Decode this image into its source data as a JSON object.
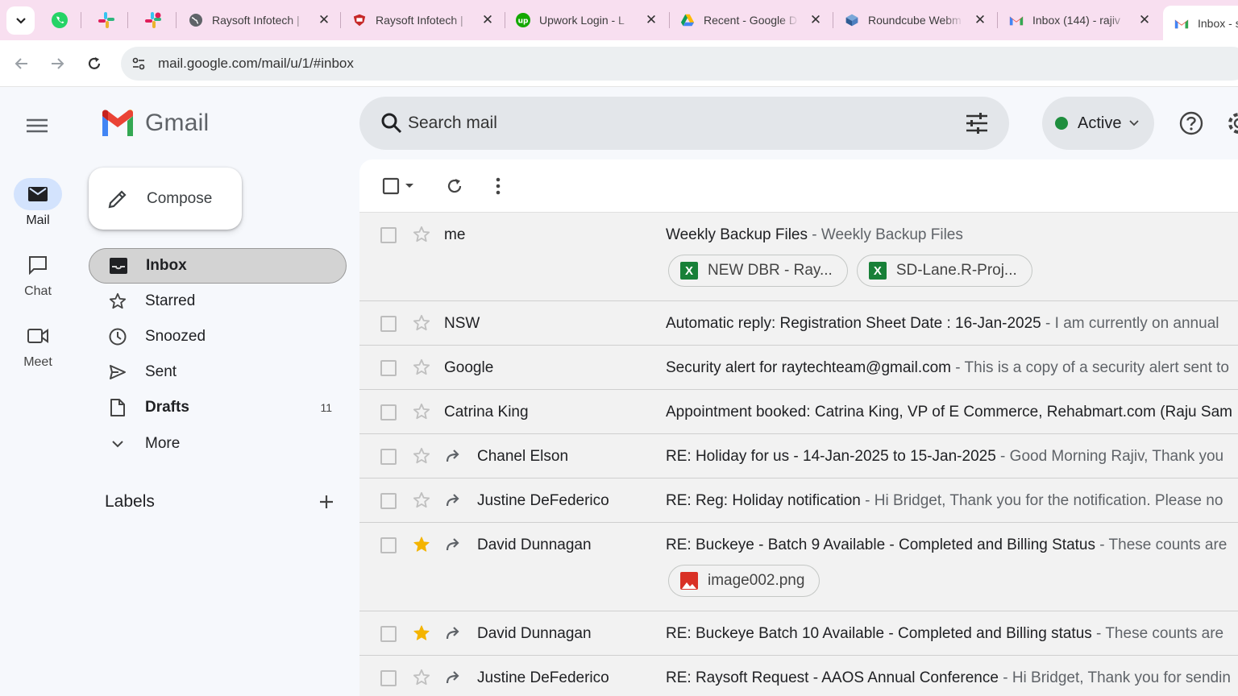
{
  "browser": {
    "tabs": [
      {
        "title": "Raysoft Infotech | ",
        "favicon": "globe-icon"
      },
      {
        "title": "Raysoft Infotech | ",
        "favicon": "raysoft-icon"
      },
      {
        "title": "Upwork Login - L",
        "favicon": "upwork-icon"
      },
      {
        "title": "Recent - Google D",
        "favicon": "google-drive-icon"
      },
      {
        "title": "Roundcube Webm",
        "favicon": "roundcube-icon"
      },
      {
        "title": "Inbox (144) - rajiv",
        "favicon": "gmail-icon"
      },
      {
        "title": "Inbox - s",
        "favicon": "gmail-icon"
      }
    ],
    "url": "mail.google.com/mail/u/1/#inbox"
  },
  "rail": {
    "mail": "Mail",
    "chat": "Chat",
    "meet": "Meet"
  },
  "app": {
    "name": "Gmail",
    "compose": "Compose",
    "folders": [
      {
        "label": "Inbox",
        "count": ""
      },
      {
        "label": "Starred",
        "count": ""
      },
      {
        "label": "Snoozed",
        "count": ""
      },
      {
        "label": "Sent",
        "count": ""
      },
      {
        "label": "Drafts",
        "count": "11"
      },
      {
        "label": "More",
        "count": ""
      }
    ],
    "labels_heading": "Labels"
  },
  "search": {
    "placeholder": "Search mail"
  },
  "status": {
    "label": "Active",
    "color": "#1e8e3e"
  },
  "emails": [
    {
      "sender": "me",
      "subject": "Weekly Backup Files",
      "snippet": " - Weekly Backup Files",
      "starred": false,
      "forwarded": false,
      "attachments": [
        {
          "name": "NEW DBR - Ray...",
          "type": "xls"
        },
        {
          "name": "SD-Lane.R-Proj...",
          "type": "xls"
        }
      ]
    },
    {
      "sender": "NSW",
      "subject": "Automatic reply: Registration Sheet Date : 16-Jan-2025",
      "snippet": " -  I am currently on annual",
      "starred": false,
      "forwarded": false,
      "attachments": []
    },
    {
      "sender": "Google",
      "subject": "Security alert for raytechteam@gmail.com",
      "snippet": " - This is a copy of a security alert sent to",
      "starred": false,
      "forwarded": false,
      "attachments": []
    },
    {
      "sender": "Catrina King",
      "subject": "Appointment booked: Catrina King, VP of E Commerce, Rehabmart.com (Raju Sam",
      "snippet": "",
      "starred": false,
      "forwarded": false,
      "attachments": []
    },
    {
      "sender": "Chanel Elson",
      "subject": "RE: Holiday for us - 14-Jan-2025 to 15-Jan-2025",
      "snippet": " - Good Morning Rajiv, Thank you",
      "starred": false,
      "forwarded": true,
      "attachments": []
    },
    {
      "sender": "Justine DeFederico",
      "subject": "RE: Reg: Holiday notification",
      "snippet": " - Hi Bridget, Thank you for the notification. Please no",
      "starred": false,
      "forwarded": true,
      "attachments": []
    },
    {
      "sender": "David Dunnagan",
      "subject": "RE: Buckeye - Batch 9 Available - Completed and Billing Status",
      "snippet": " - These counts are",
      "starred": true,
      "forwarded": true,
      "attachments": [
        {
          "name": "image002.png",
          "type": "image"
        }
      ]
    },
    {
      "sender": "David Dunnagan",
      "subject": "RE: Buckeye Batch 10 Available - Completed and Billing status",
      "snippet": " - These counts are",
      "starred": true,
      "forwarded": true,
      "attachments": []
    },
    {
      "sender": "Justine DeFederico",
      "subject": "RE: Raysoft Request - AAOS Annual Conference",
      "snippet": " - Hi Bridget, Thank you for sendin",
      "starred": false,
      "forwarded": true,
      "attachments": []
    }
  ],
  "colors": {
    "tabstrip": "#f8dff0",
    "star": "#f4b400",
    "selected_folder": "#d3d3d3"
  }
}
